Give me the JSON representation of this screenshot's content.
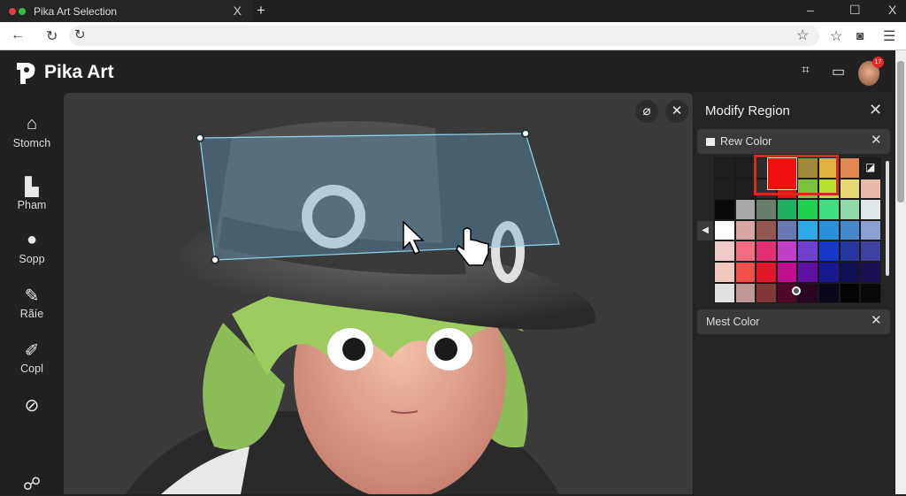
{
  "browser": {
    "tab_title": "Pika Art Selection",
    "close": "X",
    "new_tab": "+",
    "minimize": "–",
    "maximize": "☐",
    "close_window": "X"
  },
  "app": {
    "logo_text": "Pika Art",
    "notification_count": "17"
  },
  "sidebar": {
    "items": [
      {
        "label": "Stomch",
        "icon": "home-icon"
      },
      {
        "label": "Pham",
        "icon": "shapes-icon"
      },
      {
        "label": "Sopp",
        "icon": "palette-icon"
      },
      {
        "label": "Rãíe",
        "icon": "pencil-icon"
      },
      {
        "label": "Copl",
        "icon": "brush-icon"
      },
      {
        "label": "",
        "icon": "compass-icon"
      },
      {
        "label": "",
        "icon": "settings-icon"
      }
    ]
  },
  "panel": {
    "title": "Modify Region",
    "section1": "Rew Color",
    "section2": "Mest Color",
    "palette": [
      [
        "#1e1e1e",
        "#1e1e1e",
        "#2a2c2a",
        "#f01010",
        "#a08a3a",
        "#e0b040",
        "#e08850",
        "#1e1e1e"
      ],
      [
        "#1e1e1e",
        "#1e1e1e",
        "#2d302d",
        "#f01010",
        "#7ac23a",
        "#b8e030",
        "#e8d870",
        "#e8b8a8"
      ],
      [
        "#080808",
        "#a8a8a8",
        "#6a7e6e",
        "#20b060",
        "#20d050",
        "#40e080",
        "#90d8a8",
        "#e0e8ec"
      ],
      [
        "#ffffff",
        "#d8a8a8",
        "#905850",
        "#6878b0",
        "#30a8e8",
        "#2890d8",
        "#4888c8",
        "#8aa0d0"
      ],
      [
        "#f0c8c8",
        "#f07080",
        "#e03070",
        "#c040c8",
        "#7040d0",
        "#1838c8",
        "#2838a0",
        "#4040a0"
      ],
      [
        "#f0c8c0",
        "#f05048",
        "#e01828",
        "#c01090",
        "#6010a0",
        "#1a1890",
        "#101050",
        "#181050"
      ],
      [
        "#e0e0e0",
        "#c09898",
        "#803838",
        "#500828",
        "#280820",
        "#080818",
        "#050508",
        "#080808"
      ]
    ],
    "selected_color": "#f01010"
  }
}
